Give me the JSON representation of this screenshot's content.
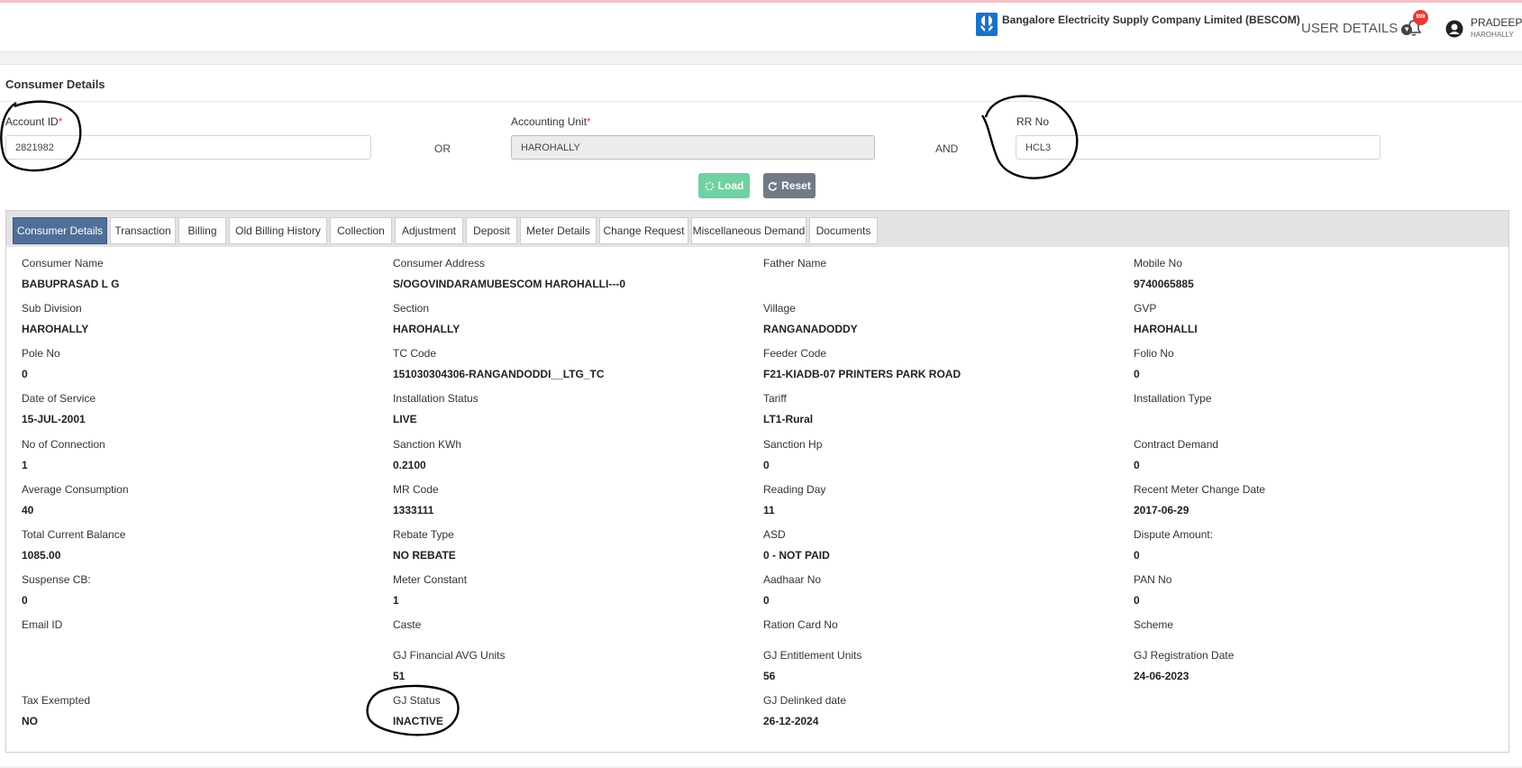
{
  "header": {
    "company": "Bangalore Electricity Supply Company Limited (BESCOM)",
    "logo_caption": "BESCOM",
    "user_details_label": "USER DETAILS",
    "notification_count": "999",
    "user_name": "PRADEEP C",
    "user_location": "HAROHALLY"
  },
  "page": {
    "title": "Consumer Details"
  },
  "search": {
    "account_id": {
      "label": "Account ID",
      "required": "*",
      "value": "2821982"
    },
    "or_label": "OR",
    "accounting_unit": {
      "label": "Accounting Unit",
      "required": "*",
      "value": "HAROHALLY"
    },
    "and_label": "AND",
    "rr_no": {
      "label": "RR No",
      "value": "HCL3"
    },
    "load_label": "Load",
    "reset_label": "Reset"
  },
  "tabs": [
    {
      "label": "Consumer Details",
      "active": true
    },
    {
      "label": "Transaction"
    },
    {
      "label": "Billing"
    },
    {
      "label": "Old Billing History"
    },
    {
      "label": "Collection"
    },
    {
      "label": "Adjustment"
    },
    {
      "label": "Deposit"
    },
    {
      "label": "Meter Details"
    },
    {
      "label": "Change Request"
    },
    {
      "label": "Miscellaneous Demand"
    },
    {
      "label": "Documents"
    }
  ],
  "details": [
    {
      "label": "Consumer Name",
      "value": "BABUPRASAD L G"
    },
    {
      "label": "Consumer Address",
      "value": "S/OGOVINDARAMUBESCOM HAROHALLI---0"
    },
    {
      "label": "Father Name",
      "value": ""
    },
    {
      "label": "Mobile No",
      "value": "9740065885"
    },
    {
      "label": "Sub Division",
      "value": "HAROHALLY"
    },
    {
      "label": "Section",
      "value": "HAROHALLY"
    },
    {
      "label": "Village",
      "value": "RANGANADODDY"
    },
    {
      "label": "GVP",
      "value": "HAROHALLI"
    },
    {
      "label": "Pole No",
      "value": "0"
    },
    {
      "label": "TC Code",
      "value": "151030304306-RANGANDODDI__LTG_TC"
    },
    {
      "label": "Feeder Code",
      "value": "F21-KIADB-07 PRINTERS PARK ROAD"
    },
    {
      "label": "Folio No",
      "value": "0"
    },
    {
      "label": "Date of Service",
      "value": "15-JUL-2001"
    },
    {
      "label": "Installation Status",
      "value": "LIVE"
    },
    {
      "label": "Tariff",
      "value": "LT1-Rural"
    },
    {
      "label": "Installation Type",
      "value": ""
    },
    {
      "label": "No of Connection",
      "value": "1"
    },
    {
      "label": "Sanction KWh",
      "value": "0.2100"
    },
    {
      "label": "Sanction Hp",
      "value": "0"
    },
    {
      "label": "Contract Demand",
      "value": "0"
    },
    {
      "label": "Average Consumption",
      "value": "40"
    },
    {
      "label": "MR Code",
      "value": "1333111"
    },
    {
      "label": "Reading Day",
      "value": "11"
    },
    {
      "label": "Recent Meter Change Date",
      "value": "2017-06-29"
    },
    {
      "label": "Total Current Balance",
      "value": "1085.00"
    },
    {
      "label": "Rebate Type",
      "value": "NO REBATE"
    },
    {
      "label": "ASD",
      "value": "0 - NOT PAID"
    },
    {
      "label": "Dispute Amount:",
      "value": "0"
    },
    {
      "label": "Suspense CB:",
      "value": "0"
    },
    {
      "label": "Meter Constant",
      "value": "1"
    },
    {
      "label": "Aadhaar No",
      "value": "0"
    },
    {
      "label": "PAN No",
      "value": "0"
    },
    {
      "label": "Email ID",
      "value": ""
    },
    {
      "label": "Caste",
      "value": ""
    },
    {
      "label": "Ration Card No",
      "value": ""
    },
    {
      "label": "Scheme",
      "value": ""
    },
    {
      "label": "",
      "value": ""
    },
    {
      "label": "GJ Financial AVG Units",
      "value": "51"
    },
    {
      "label": "GJ Entitlement Units",
      "value": "56"
    },
    {
      "label": "GJ Registration Date",
      "value": "24-06-2023"
    },
    {
      "label": "Tax Exempted",
      "value": "NO"
    },
    {
      "label": "GJ Status",
      "value": "INACTIVE"
    },
    {
      "label": "GJ Delinked date",
      "value": "26-12-2024"
    }
  ]
}
